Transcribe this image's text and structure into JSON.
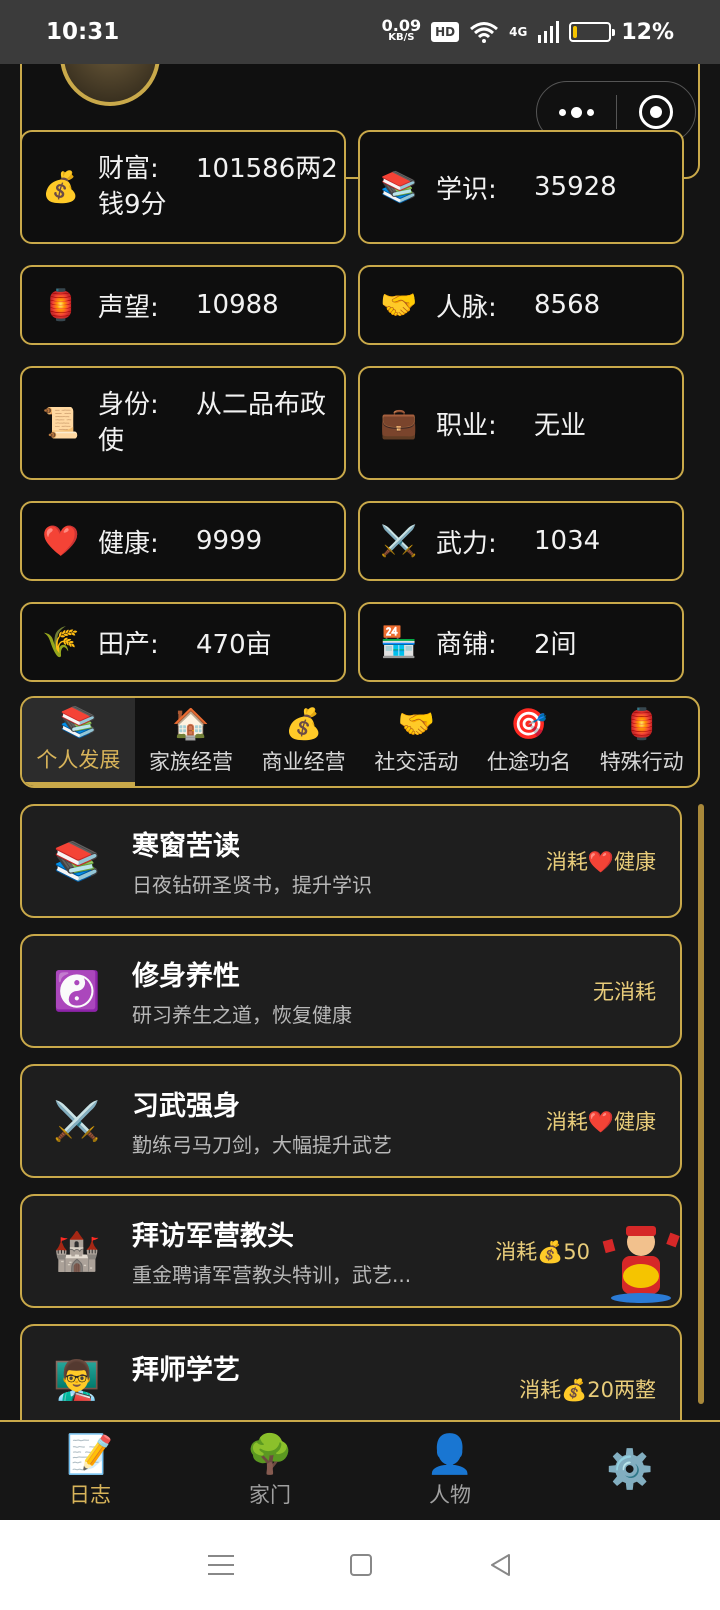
{
  "status_bar": {
    "time": "10:31",
    "net_speed": "0.09",
    "net_unit": "KB/S",
    "hd": "HD",
    "network": "4G",
    "battery_percent": "12%",
    "battery_level": 0.12
  },
  "stats": {
    "wealth": {
      "icon": "💰",
      "label": "财富:",
      "value": "101586两2钱9分"
    },
    "knowledge": {
      "icon": "📚",
      "label": "学识:",
      "value": "35928"
    },
    "reputation": {
      "icon": "🏮",
      "label": "声望:",
      "value": "10988"
    },
    "connections": {
      "icon": "🤝",
      "label": "人脉:",
      "value": "8568"
    },
    "identity": {
      "icon": "📜",
      "label": "身份:",
      "value": "从二品布政使"
    },
    "occupation": {
      "icon": "💼",
      "label": "职业:",
      "value": "无业"
    },
    "health": {
      "icon": "❤️",
      "label": "健康:",
      "value": "9999"
    },
    "martial": {
      "icon": "⚔️",
      "label": "武力:",
      "value": "1034"
    },
    "farmland": {
      "icon": "🌾",
      "label": "田产:",
      "value": "470亩"
    },
    "shops": {
      "icon": "🏪",
      "label": "商铺:",
      "value": "2间"
    }
  },
  "tabs": [
    {
      "icon": "📚",
      "label": "个人发展",
      "active": true
    },
    {
      "icon": "🏠",
      "label": "家族经营"
    },
    {
      "icon": "💰",
      "label": "商业经营"
    },
    {
      "icon": "🤝",
      "label": "社交活动"
    },
    {
      "icon": "🎯",
      "label": "仕途功名"
    },
    {
      "icon": "🏮",
      "label": "特殊行动"
    }
  ],
  "actions": [
    {
      "icon": "📚",
      "title": "寒窗苦读",
      "desc": "日夜钻研圣贤书，提升学识",
      "cost": "消耗❤️健康"
    },
    {
      "icon": "☯️",
      "title": "修身养性",
      "desc": "研习养生之道，恢复健康",
      "cost": "无消耗"
    },
    {
      "icon": "⚔️",
      "title": "习武强身",
      "desc": "勤练弓马刀剑，大幅提升武艺",
      "cost": "消耗❤️健康"
    },
    {
      "icon": "🏰",
      "title": "拜访军营教头",
      "desc": "重金聘请军营教头特训，武艺...",
      "cost": "消耗💰50"
    },
    {
      "icon": "👨‍🏫",
      "title": "拜师学艺",
      "desc": "",
      "cost": "消耗💰20两整"
    }
  ],
  "bottom_nav": [
    {
      "icon": "📝",
      "label": "日志",
      "active": true
    },
    {
      "icon": "🌳",
      "label": "家门"
    },
    {
      "icon": "👤",
      "label": "人物"
    },
    {
      "icon": "⚙️",
      "label": ""
    }
  ],
  "colors": {
    "accent": "#c9a94a",
    "active_text": "#d8b45a",
    "background": "#141414"
  }
}
